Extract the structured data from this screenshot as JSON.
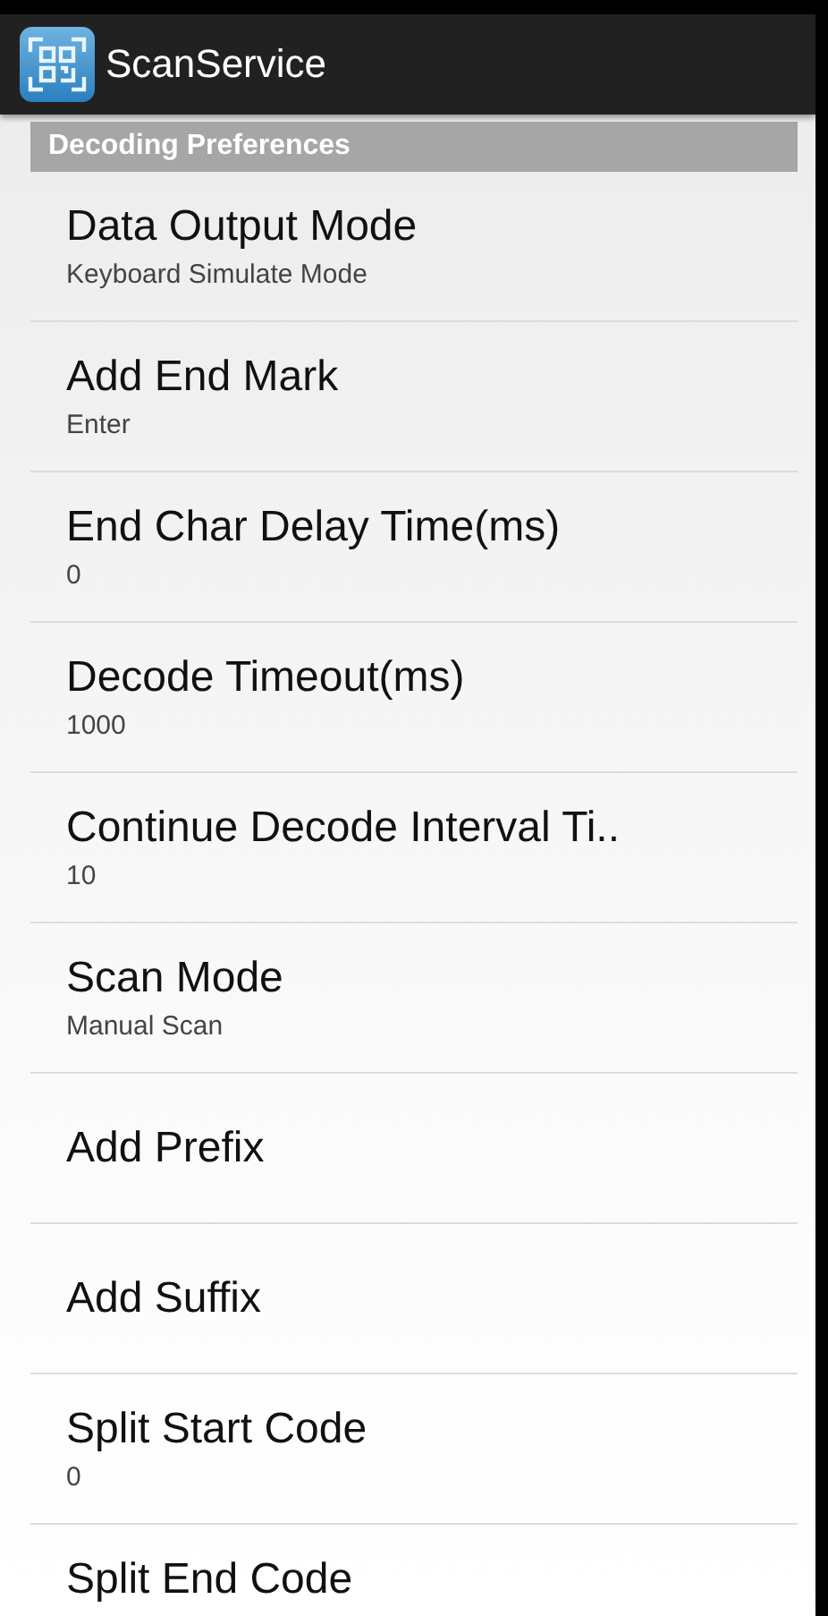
{
  "app_bar": {
    "title": "ScanService"
  },
  "category": {
    "title": "Decoding Preferences"
  },
  "preferences": [
    {
      "title": "Data Output Mode",
      "summary": "Keyboard Simulate Mode"
    },
    {
      "title": "Add End Mark",
      "summary": "Enter"
    },
    {
      "title": "End Char Delay Time(ms)",
      "summary": "0"
    },
    {
      "title": "Decode Timeout(ms)",
      "summary": "1000"
    },
    {
      "title": "Continue Decode Interval Ti..",
      "summary": "10"
    },
    {
      "title": "Scan Mode",
      "summary": "Manual Scan"
    },
    {
      "title": "Add Prefix"
    },
    {
      "title": "Add Suffix"
    },
    {
      "title": "Split Start Code",
      "summary": "0"
    },
    {
      "title": "Split End Code"
    }
  ]
}
